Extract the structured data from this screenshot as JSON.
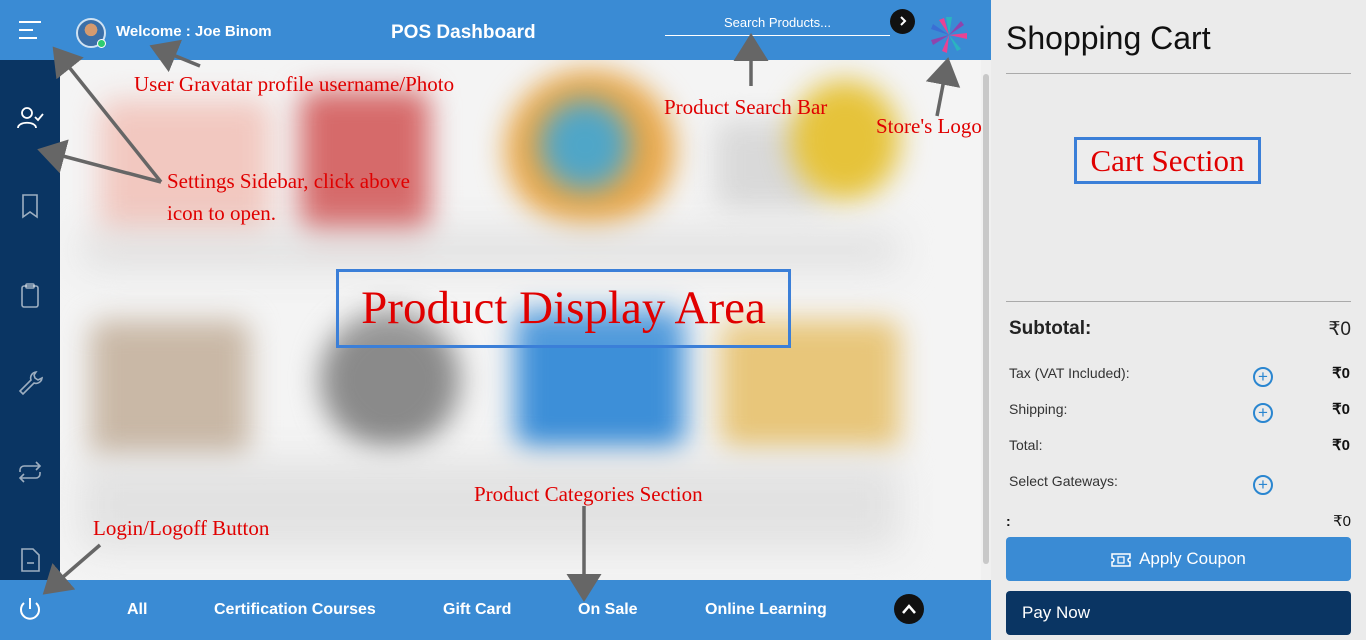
{
  "header": {
    "welcome": "Welcome : Joe Binom",
    "title": "POS Dashboard",
    "search_placeholder": "Search Products..."
  },
  "sidebar": {
    "icons": [
      "menu-icon",
      "user-check-icon",
      "bookmark-icon",
      "clipboard-icon",
      "wrench-icon",
      "repeat-icon",
      "file-minus-icon",
      "power-icon"
    ]
  },
  "categories": [
    "All",
    "Certification Courses",
    "Gift Card",
    "On Sale",
    "Online Learning"
  ],
  "cart": {
    "title": "Shopping Cart",
    "subtotal_label": "Subtotal:",
    "subtotal_value": "₹0",
    "tax_label": "Tax (VAT Included):",
    "tax_value": "₹0",
    "shipping_label": "Shipping:",
    "shipping_value": "₹0",
    "total_label": "Total:",
    "total_value": "₹0",
    "gateways_label": "Select Gateways:",
    "colon_label": ":",
    "colon_value": "₹0",
    "coupon_label": "Apply Coupon",
    "pay_label": "Pay Now"
  },
  "annotations": {
    "gravatar": "User Gravatar profile username/Photo",
    "search_bar": "Product Search Bar",
    "store_logo": "Store's Logo",
    "settings_line1": "Settings Sidebar, click above",
    "settings_line2": "icon to open.",
    "cart_section": "Cart Section",
    "display_area": "Product Display Area",
    "categories": "Product Categories Section",
    "login": "Login/Logoff Button"
  },
  "colors": {
    "primary": "#3a8bd4",
    "sidebar": "#0a3563",
    "annotation": "#e00000",
    "box_border": "#3b7fd8"
  }
}
